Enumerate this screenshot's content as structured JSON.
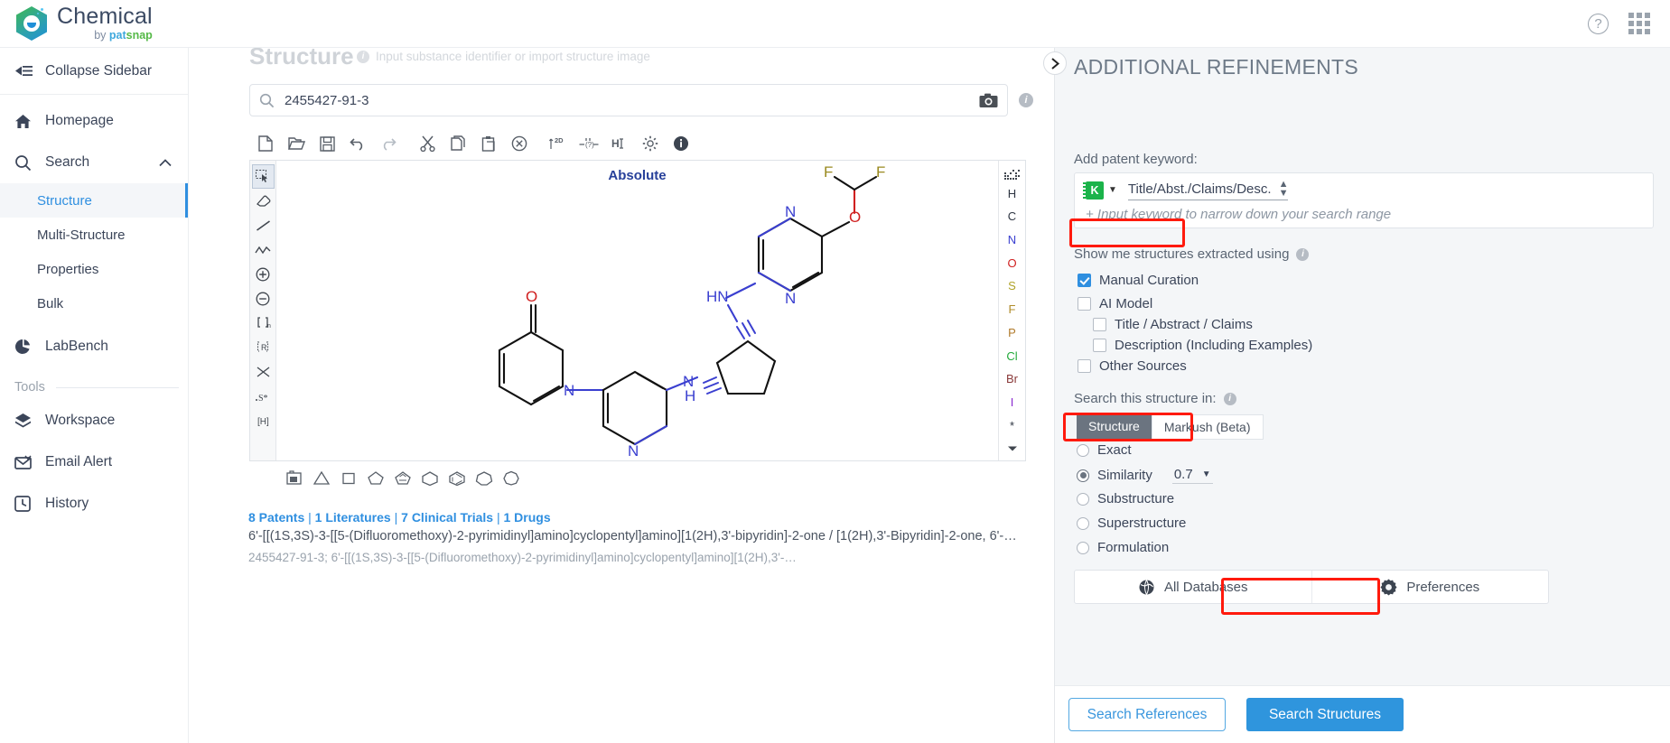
{
  "topbar": {
    "brand_name": "Chemical",
    "brand_by": "by ",
    "brand_pat": "pat",
    "brand_snap": "snap",
    "help_glyph": "?",
    "help_name": "help-icon",
    "apps_name": "app-grid-icon"
  },
  "sidebar": {
    "collapse_label": "Collapse Sidebar",
    "items": [
      {
        "label": "Homepage",
        "icon": "home-icon"
      },
      {
        "label": "Search",
        "icon": "search-icon",
        "expanded": true
      },
      {
        "label": "LabBench",
        "icon": "labbench-icon"
      }
    ],
    "search_children": [
      {
        "label": "Structure",
        "active": true
      },
      {
        "label": "Multi-Structure",
        "active": false
      },
      {
        "label": "Properties",
        "active": false
      },
      {
        "label": "Bulk",
        "active": false
      }
    ],
    "tools_header": "Tools",
    "tools": [
      {
        "label": "Workspace",
        "icon": "workspace-icon"
      },
      {
        "label": "Email Alert",
        "icon": "email-alert-icon"
      },
      {
        "label": "History",
        "icon": "history-icon"
      }
    ]
  },
  "main": {
    "page_title": "Structure",
    "page_hint": "Input substance identifier or import structure image",
    "search": {
      "value": "2455427-91-3",
      "placeholder": "Input substance identifier",
      "camera_name": "camera-icon",
      "magnifier_name": "search-icon",
      "info_name": "info-icon"
    },
    "editor": {
      "absolute_label": "Absolute",
      "toolbar": [
        "new-file-icon",
        "open-folder-icon",
        "save-icon",
        "undo-icon",
        "redo-icon",
        "cut-icon",
        "copy-icon",
        "paste-icon",
        "clear-icon",
        "layout-2d-icon",
        "bond-query-icon",
        "add-hydrogen-icon",
        "settings-gear-icon",
        "info-circle-icon"
      ],
      "left_tools": [
        "select-lasso-icon",
        "eraser-icon",
        "single-bond-icon",
        "chain-icon",
        "plus-charge-icon",
        "minus-charge-icon",
        "bracket-n-icon",
        "r-group-icon",
        "arrow-tool-icon",
        "stereo-s-icon",
        "h-bracket-icon"
      ],
      "periodic_elements": [
        "H",
        "C",
        "N",
        "O",
        "S",
        "F",
        "P",
        "Cl",
        "Br",
        "I",
        "*"
      ],
      "periodic_top_icon": "periodic-table-icon",
      "periodic_more_icon": "chevron-down-icon",
      "ring_tools": [
        "template-icon",
        "cyclopropane-icon",
        "cyclobutane-icon",
        "cyclopentane-icon",
        "cyclopentadiene-icon",
        "cyclohexane-icon",
        "benzene-icon",
        "cycloheptane-icon",
        "cyclooctane-icon"
      ]
    },
    "result": {
      "counts": [
        {
          "text": "8 Patents"
        },
        {
          "text": "1 Literatures"
        },
        {
          "text": "7 Clinical Trials"
        },
        {
          "text": "1 Drugs"
        }
      ],
      "separator": " | ",
      "name": "6'-[[(1S,3S)-3-[[5-(Difluoromethoxy)-2-pyrimidinyl]amino]cyclopentyl]amino][1(2H),3'-bipyridin]-2-one / [1(2H),3'-Bipyridin]-2-one, 6'-…",
      "subline": "2455427-91-3; 6'-[[(1S,3S)-3-[[5-(Difluoromethoxy)-2-pyrimidinyl]amino]cyclopentyl]amino][1(2H),3'-…"
    }
  },
  "refinements": {
    "title": "ADDITIONAL REFINEMENTS",
    "collapse_icon": "chevron-right-icon",
    "keyword_label": "Add patent keyword:",
    "keyword_field_badge": "K",
    "keyword_scope": "Title/Abst./Claims/Desc.",
    "keyword_placeholder": "+ Input keyword to narrow down your search range",
    "extracted_label": "Show me structures extracted using",
    "extracted_info": "info-icon",
    "checkboxes": [
      {
        "label": "Manual Curation",
        "checked": true,
        "indent": 0,
        "highlight": true
      },
      {
        "label": "AI Model",
        "checked": false,
        "indent": 0,
        "highlight": false
      },
      {
        "label": "Title / Abstract / Claims",
        "checked": false,
        "indent": 1,
        "highlight": false
      },
      {
        "label": "Description (Including Examples)",
        "checked": false,
        "indent": 1,
        "highlight": false
      },
      {
        "label": "Other Sources",
        "checked": false,
        "indent": 0,
        "highlight": false
      }
    ],
    "search_in_label": "Search this structure in:",
    "search_in_info": "info-icon",
    "segments": [
      {
        "label": "Structure",
        "selected": true
      },
      {
        "label": "Markush (Beta)",
        "selected": false
      }
    ],
    "radios": [
      {
        "label": "Exact",
        "selected": false,
        "highlight": false
      },
      {
        "label": "Similarity",
        "selected": true,
        "value": "0.7",
        "highlight": true
      },
      {
        "label": "Substructure",
        "selected": false,
        "highlight": false
      },
      {
        "label": "Superstructure",
        "selected": false,
        "highlight": false
      },
      {
        "label": "Formulation",
        "selected": false,
        "highlight": false
      }
    ],
    "db_buttons": [
      {
        "label": "All Databases",
        "icon": "globe-icon"
      },
      {
        "label": "Preferences",
        "icon": "gear-icon"
      }
    ],
    "search_references_label": "Search References",
    "search_structures_label": "Search Structures",
    "accent_blue": "#2f95dd",
    "highlight_red": "#ff1a0d"
  }
}
